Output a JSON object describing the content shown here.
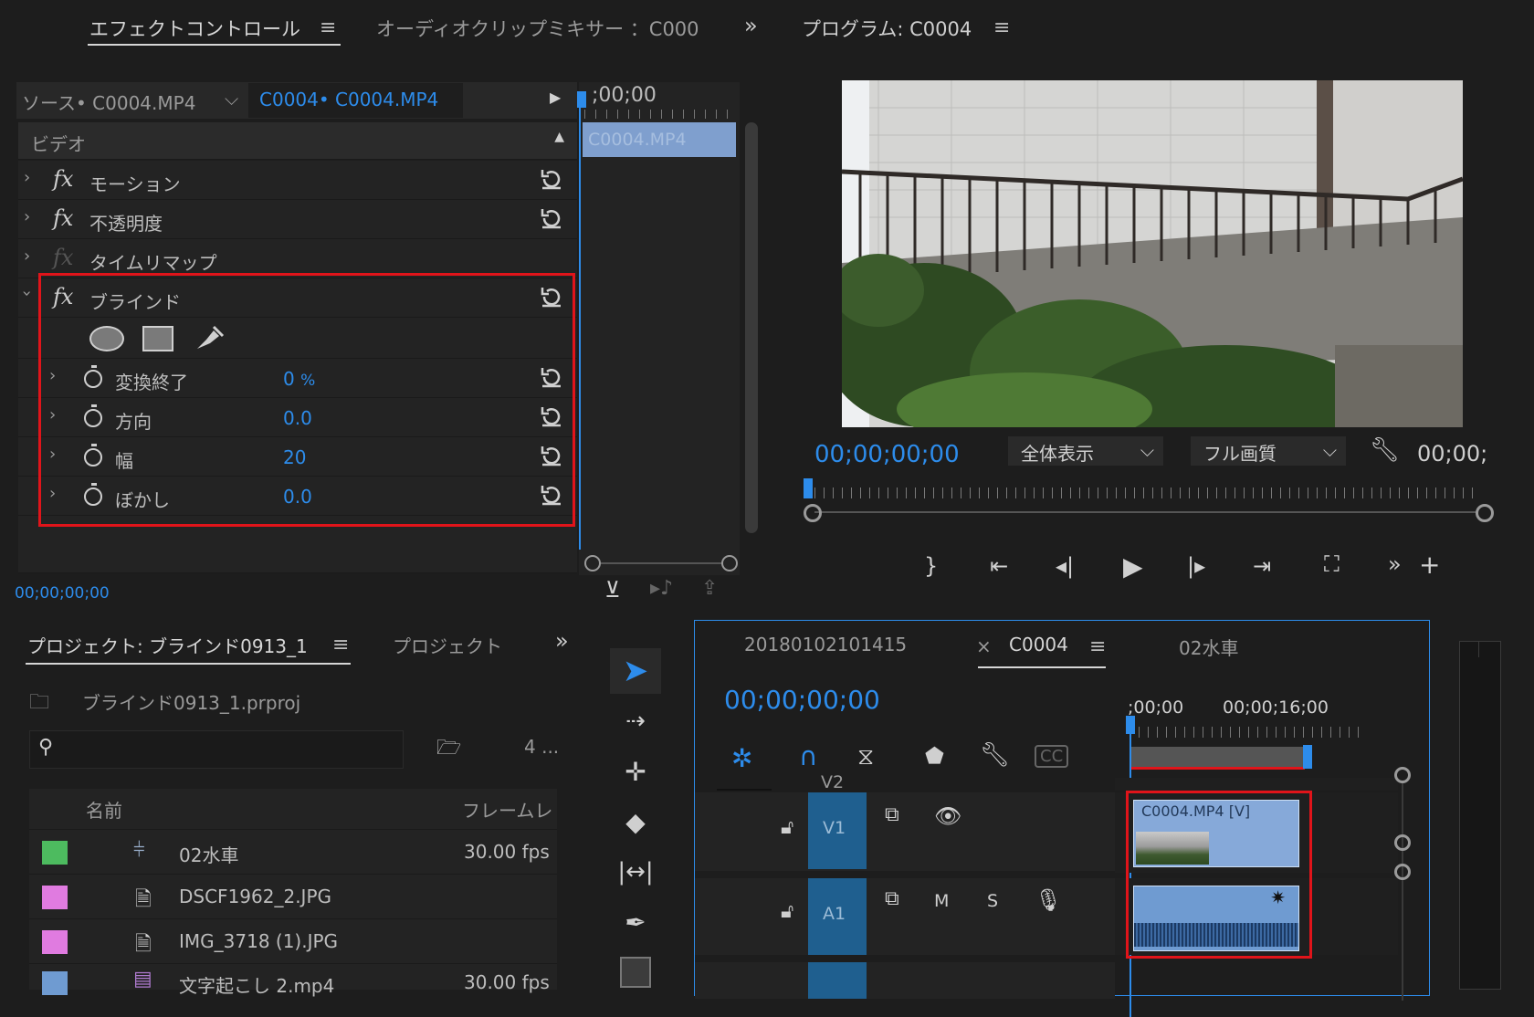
{
  "effect_controls": {
    "tab_active": "エフェクトコントロール",
    "tab_inactive": "オーディオクリップミキサー ：C000",
    "source_label": "ソース• C0004.MP4",
    "sequence_label": "C0004• C0004.MP4",
    "timecode_ruler": ";00;00",
    "clip_label": "C0004.MP4",
    "section_video": "ビデオ",
    "effects": [
      {
        "name": "モーション"
      },
      {
        "name": "不透明度"
      },
      {
        "name": "タイムリマップ"
      },
      {
        "name": "ブラインド"
      }
    ],
    "params": [
      {
        "name": "変換終了",
        "value": "0",
        "unit": "%"
      },
      {
        "name": "方向",
        "value": "0.0"
      },
      {
        "name": "幅",
        "value": "20"
      },
      {
        "name": "ぼかし",
        "value": "0.0"
      }
    ],
    "footer_timecode": "00;00;00;00"
  },
  "program": {
    "title": "プログラム: C0004",
    "timecode": "00;00;00;00",
    "zoom_select": "全体表示",
    "quality_select": "フル画質",
    "duration": "00;00;"
  },
  "project": {
    "tab_active": "プロジェクト: ブラインド0913_1",
    "tab_inactive": "プロジェクト",
    "file_name": "ブラインド0913_1.prproj",
    "item_count": "4 ...",
    "col_name": "名前",
    "col_framerate": "フレームレ",
    "items": [
      {
        "name": "02水車",
        "fps": "30.00 fps",
        "color": "#4dbb5f",
        "icon": "sequence-icon"
      },
      {
        "name": "DSCF1962_2.JPG",
        "fps": "",
        "color": "#e07be0",
        "icon": "image-file-icon"
      },
      {
        "name": "IMG_3718 (1).JPG",
        "fps": "",
        "color": "#e07be0",
        "icon": "image-file-icon"
      },
      {
        "name": "文字起こし 2.mp4",
        "fps": "30.00 fps",
        "color": "#6f9bd1",
        "icon": "video-file-icon"
      }
    ]
  },
  "timeline": {
    "tabs": [
      "20180102101415",
      "C0004",
      "02水車"
    ],
    "close": "×",
    "timecode": "00;00;00;00",
    "ruler_start": ";00;00",
    "ruler_mid": "00;00;16;00",
    "tracks": {
      "v2": "V2",
      "v1": "V1",
      "a1": "A1",
      "m": "M",
      "s": "S"
    },
    "clip_label": "C0004.MP4 [V]"
  }
}
